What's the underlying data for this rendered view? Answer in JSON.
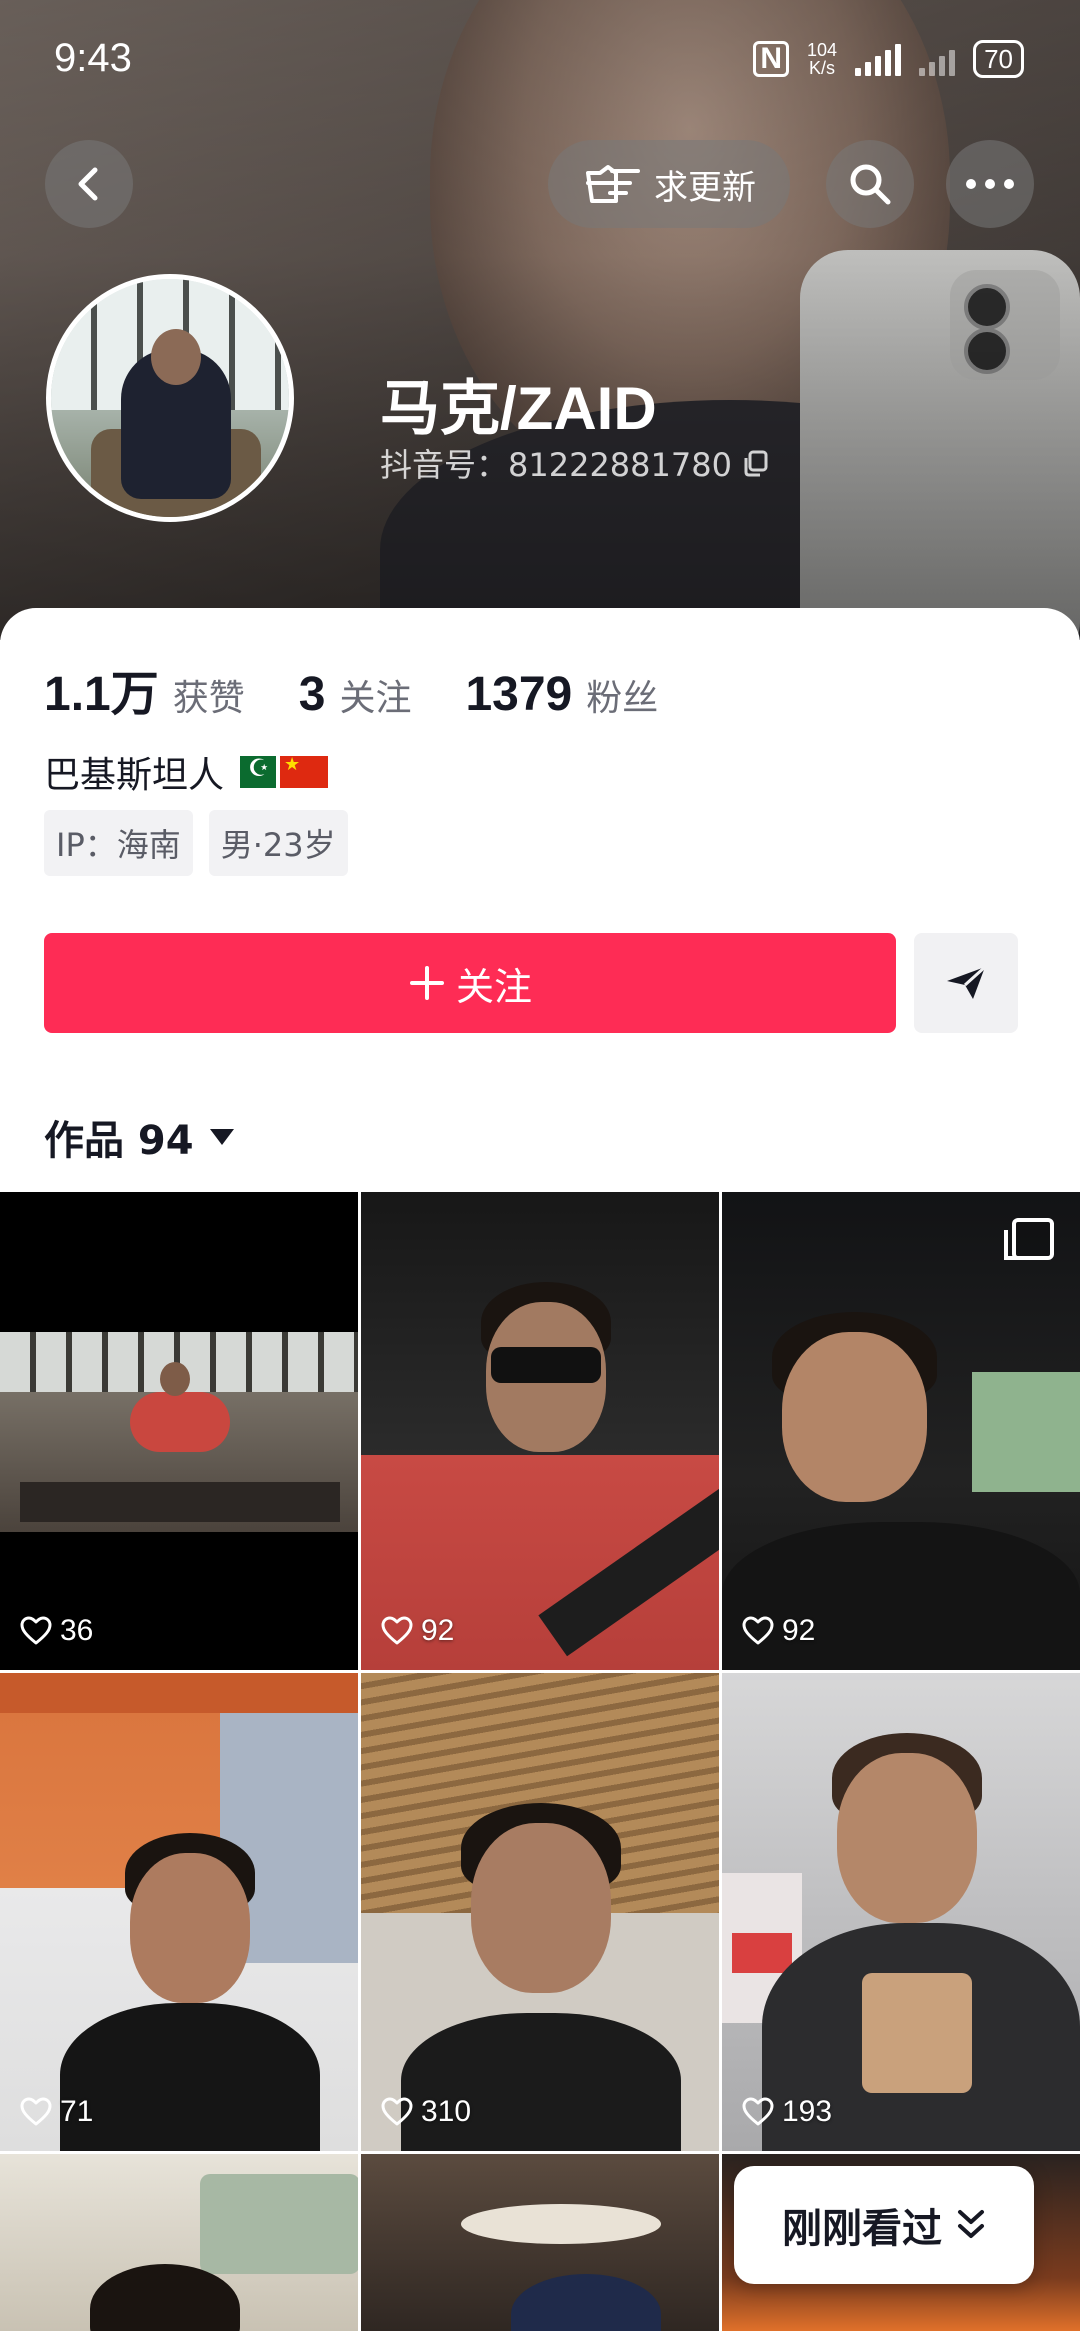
{
  "status_bar": {
    "time": "9:43",
    "speed_value": "104",
    "speed_unit": "K/s",
    "battery": "70"
  },
  "header": {
    "request_update_label": "求更新",
    "name": "马克/ZAID",
    "douyin_id": "抖音号：81222881780"
  },
  "stats": [
    {
      "num": "1.1万",
      "label": "获赞"
    },
    {
      "num": "3",
      "label": "关注"
    },
    {
      "num": "1379",
      "label": "粉丝"
    }
  ],
  "bio": {
    "text": "巴基斯坦人"
  },
  "tags": {
    "ip": "IP：海南",
    "gender_age": "男·23岁"
  },
  "follow_button": {
    "label": "关注"
  },
  "works": {
    "title": "作品 94"
  },
  "videos": [
    {
      "likes": "36"
    },
    {
      "likes": "92"
    },
    {
      "likes": "92"
    },
    {
      "likes": "71"
    },
    {
      "likes": "310"
    },
    {
      "likes": "193"
    }
  ],
  "recent_button": {
    "label": "刚刚看过"
  },
  "colors": {
    "accent": "#fe2c55"
  }
}
